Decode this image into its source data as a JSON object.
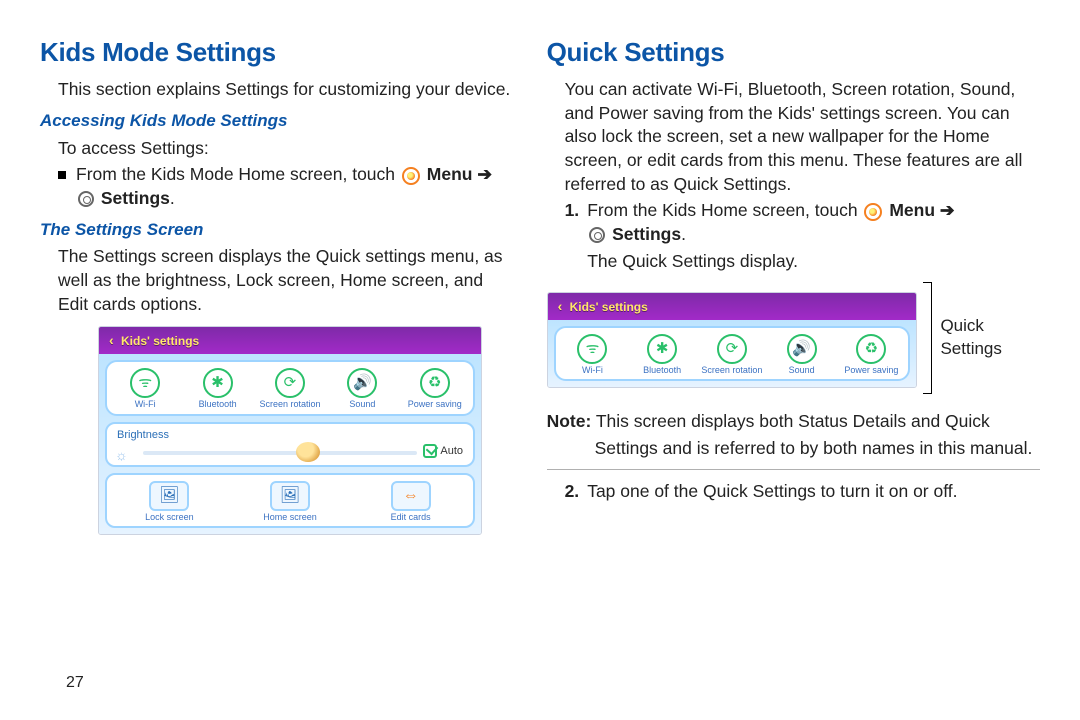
{
  "left": {
    "h1": "Kids Mode Settings",
    "intro": "This section explains Settings for customizing your device.",
    "h2a": "Accessing Kids Mode Settings",
    "access": "To access Settings:",
    "bullet_pre": "From the Kids Mode Home screen, touch ",
    "menu_word": "Menu",
    "arrow": "➔",
    "settings_word": "Settings",
    "period": ".",
    "h2b": "The Settings Screen",
    "para_b": "The Settings screen displays the Quick settings menu, as well as the brightness, Lock screen, Home screen, and Edit cards options.",
    "page_num": "27"
  },
  "right": {
    "h1": "Quick Settings",
    "para1": "You can activate Wi-Fi, Bluetooth, Screen rotation, Sound, and Power saving from the Kids' settings screen. You can also lock the screen, set a new wallpaper for the Home screen, or edit cards from this menu. These features are all referred to as Quick Settings.",
    "step1_num": "1.",
    "step1_pre": "From the Kids Home screen, touch ",
    "menu_word": "Menu",
    "arrow": "➔",
    "settings_word": "Settings",
    "period": ".",
    "step1_post": "The Quick Settings display.",
    "label_quick": "Quick Settings",
    "note_label": "Note:",
    "note_body_a": " This screen displays both Status Details and Quick",
    "note_body_b": "Settings and is referred to by both names in this manual.",
    "step2_num": "2.",
    "step2": "Tap one of the Quick Settings to turn it on or off."
  },
  "shot": {
    "header": "Kids' settings",
    "qs": [
      "Wi-Fi",
      "Bluetooth",
      "Screen rotation",
      "Sound",
      "Power saving"
    ],
    "brightness": "Brightness",
    "auto": "Auto",
    "buttons": [
      "Lock screen",
      "Home screen",
      "Edit cards"
    ]
  }
}
